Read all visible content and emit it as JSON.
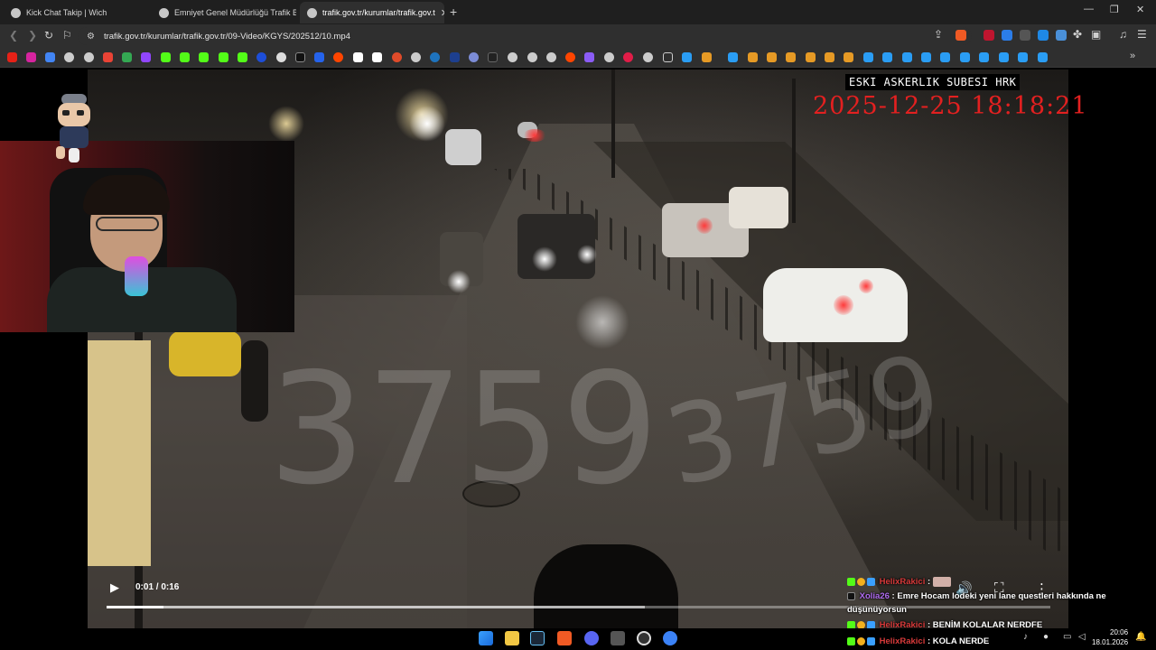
{
  "browser": {
    "tabs": [
      {
        "label": "Kick Chat Takip | Wich",
        "active": false
      },
      {
        "label": "Emniyet Genel Müdürlüğü Trafik Başk",
        "active": false
      },
      {
        "label": "trafik.gov.tr/kurumlar/trafik.gov.t",
        "active": true
      }
    ],
    "new_tab": "+",
    "window_controls": {
      "minimize": "—",
      "restore": "❐",
      "close": "✕"
    },
    "url": "trafik.gov.tr/kurumlar/trafik.gov.tr/09-Video/KGYS/202512/10.mp4",
    "bookmarks_more": "»"
  },
  "video": {
    "camera_label": "ESKI ASKERLIK SUBESI HRK",
    "camera_timestamp": "2025-12-25  18:18:21",
    "watermark": "3759",
    "current_time": "0:01 / 0:16",
    "progress": 0.06,
    "buffered": 0.57,
    "play_icon": "▶",
    "volume_icon": "🔊",
    "fullscreen_icon": "⛶",
    "more_icon": "⋮"
  },
  "chat": [
    {
      "user": "HelixRakici",
      "user_color": "#d83a3a",
      "message": "",
      "has_emote": true
    },
    {
      "user": "Xolia26",
      "user_color": "#b06cf0",
      "message": "Emre Hocam lodeki yeni lane questleri hakkında ne düşünüyorsun"
    },
    {
      "user": "HelixRakici",
      "user_color": "#d83a3a",
      "message": "BENİM KOLALAR NERDFE"
    },
    {
      "user": "HelixRakici",
      "user_color": "#d83a3a",
      "message": "KOLA NERDE"
    }
  ],
  "chat_separator": " : ",
  "taskbar": {
    "time": "20:06",
    "date": "18.01.2026"
  },
  "colors": {
    "browser_bg": "#1f1f1f",
    "toolbar_bg": "#2f2f2f",
    "timestamp_red": "#e32020",
    "kick_green": "#53fc18"
  }
}
